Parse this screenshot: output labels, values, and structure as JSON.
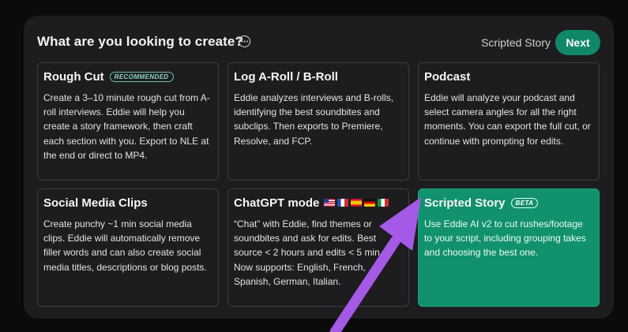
{
  "header": {
    "title": "What are you looking to create?",
    "selected": "Scripted Story",
    "next_label": "Next"
  },
  "cards": [
    {
      "title": "Rough Cut",
      "badge": "RECOMMENDED",
      "description": "Create a 3–10 minute rough cut from A-roll interviews. Eddie will help you create a story framework, then craft each section with you. Export to NLE at the end or direct to MP4."
    },
    {
      "title": "Log A-Roll / B-Roll",
      "description": "Eddie analyzes interviews and B-rolls, identifying the best soundbites and subclips. Then exports to Premiere, Resolve, and FCP."
    },
    {
      "title": "Podcast",
      "description": "Eddie will analyze your podcast and select camera angles for all the right moments. You can export the full cut, or continue with prompting for edits."
    },
    {
      "title": "Social Media Clips",
      "description": "Create punchy ~1 min social media clips. Eddie will automatically remove filler words and can also create social media titles, descriptions or blog posts."
    },
    {
      "title": "ChatGPT mode",
      "flags": [
        "us-flag-icon",
        "fr-flag-icon",
        "es-flag-icon",
        "de-flag-icon",
        "it-flag-icon"
      ],
      "description": "“Chat” with Eddie, find themes or soundbites and ask for edits. Best source < 2 hours and edits < 5 min. Now supports: English, French, Spanish, German, Italian."
    },
    {
      "title": "Scripted Story",
      "badge": "BETA",
      "selected": true,
      "description": "Use Eddie AI v2 to cut rushes/footage to your script, including grouping takes and choosing the best one."
    }
  ],
  "colors": {
    "accent": "#11876a",
    "selected_card": "#12916e",
    "arrow": "#a45ae6"
  },
  "icons": {
    "help": "more-horizontal-circle-icon",
    "pointer": "annotation-arrow-icon"
  }
}
